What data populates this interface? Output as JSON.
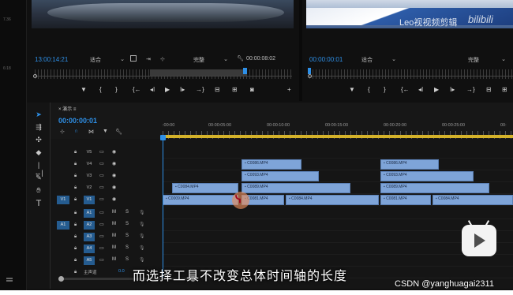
{
  "source_monitor": {
    "timecode": "13:00:14:21",
    "fit": "适合",
    "quality": "完整",
    "duration": "00:00:08:02"
  },
  "program_monitor": {
    "timecode": "00:00:00:01",
    "fit": "适合",
    "quality": "完整",
    "watermark": "Leo视视频剪辑",
    "watermark2": "bilibili"
  },
  "left_strip": {
    "cap1": "7.36",
    "cap2": "6:18"
  },
  "timeline": {
    "tab_label": "×  演示  ≡",
    "sequence_timecode": "00:00:00:01",
    "ruler_ticks": [
      ":00:00",
      "00:00:05:00",
      "00:00:10:00",
      "00:00:15:00",
      "00:00:20:00",
      "00:00:25:00",
      "00:"
    ],
    "tracks": [
      {
        "name": "V5",
        "type": "video"
      },
      {
        "name": "V4",
        "type": "video"
      },
      {
        "name": "V3",
        "type": "video"
      },
      {
        "name": "V2",
        "type": "video"
      },
      {
        "name": "V1",
        "type": "video",
        "source_patch": "V1"
      },
      {
        "name": "A1",
        "type": "audio"
      },
      {
        "name": "A2",
        "type": "audio",
        "source_patch": "A1"
      },
      {
        "name": "A3",
        "type": "audio"
      },
      {
        "name": "A4",
        "type": "audio"
      },
      {
        "name": "A5",
        "type": "audio"
      },
      {
        "name": "主声道",
        "type": "master",
        "value": "0.0"
      }
    ],
    "clips": {
      "V4": [
        "C0086.MP4",
        "C0086.MP4"
      ],
      "V3": [
        "C0093.MP4",
        "C0093.MP4"
      ],
      "V2": [
        "C0084.MP4",
        "C0089.MP4",
        "C0089.MP4"
      ],
      "V1": [
        "C0009.MP4",
        "C0081.MP4",
        "C0084.MP4",
        "C0081.MP4",
        "C0084.MP4"
      ]
    },
    "audio_labels": {
      "m": "M",
      "s": "S"
    }
  },
  "subtitle": "而选择工具不改变总体时间轴的长度",
  "credit": "CSDN @yanghuagai2311",
  "colors": {
    "accent_blue": "#2e8fe6",
    "clip": "#7ea4d8",
    "workarea": "#d4b22a"
  }
}
